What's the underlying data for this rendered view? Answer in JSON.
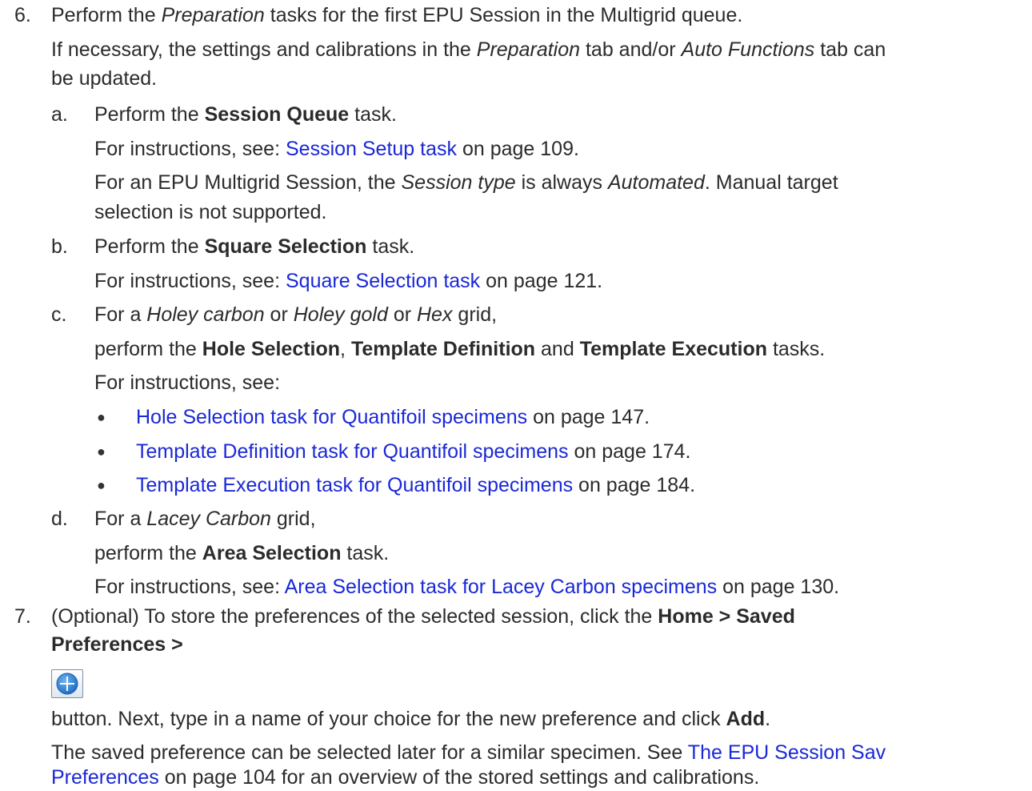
{
  "step6": {
    "number": "6.",
    "line1": [
      "Perform the ",
      "Preparation",
      " tasks for the first EPU Session in the Multigrid queue."
    ],
    "line2": [
      "If necessary, the settings and calibrations in the ",
      "Preparation",
      " tab and/or ",
      "Auto Functions",
      " tab can"
    ],
    "line3": "be updated.",
    "a": {
      "letter": "a.",
      "line1": [
        "Perform the ",
        "Session Queue",
        " task."
      ],
      "line2": [
        "For instructions, see: ",
        "Session Setup task",
        " on page 109."
      ],
      "line3": [
        "For an EPU Multigrid Session, the ",
        "Session type",
        " is always ",
        "Automated",
        ". Manual target"
      ],
      "line4": "selection is not supported."
    },
    "b": {
      "letter": "b.",
      "line1": [
        "Perform the ",
        "Square Selection",
        " task."
      ],
      "line2": [
        "For instructions, see: ",
        "Square Selection task",
        " on page 121."
      ]
    },
    "c": {
      "letter": "c.",
      "line1": [
        "For a ",
        "Holey carbon",
        " or ",
        "Holey gold",
        " or ",
        "Hex",
        " grid,"
      ],
      "line2": [
        "perform the ",
        "Hole Selection",
        ", ",
        "Template Definition",
        " and ",
        "Template Execution",
        " tasks."
      ],
      "line3": "For instructions, see:",
      "bullets": [
        {
          "symbol": "●",
          "link": "Hole Selection task for Quantifoil specimens",
          "suffix": " on page 147."
        },
        {
          "symbol": "●",
          "link": "Template Definition task for Quantifoil specimens",
          "suffix": " on page 174."
        },
        {
          "symbol": "●",
          "link": "Template Execution task for Quantifoil specimens",
          "suffix": " on page 184."
        }
      ]
    },
    "d": {
      "letter": "d.",
      "line1": [
        "For a ",
        "Lacey Carbon",
        " grid,"
      ],
      "line2": [
        "perform the ",
        "Area Selection",
        " task."
      ],
      "line3": [
        "For instructions, see: ",
        "Area Selection task for Lacey Carbon specimens",
        " on page 130."
      ]
    }
  },
  "step7": {
    "number": "7.",
    "line1": [
      "(Optional) To store the preferences of the selected session, click the ",
      "Home > Saved"
    ],
    "line2": "Preferences >",
    "add_icon": "add-circle-icon",
    "line3": [
      "button. Next, type in a name of your choice for the new preference and click ",
      "Add",
      "."
    ],
    "line4": [
      "The saved preference can be selected later for a similar specimen. See ",
      "The EPU Session Sav"
    ],
    "line5": [
      "Preferences",
      " on page 104 for an overview of the stored settings and calibrations."
    ]
  },
  "colors": {
    "text": "#2b2b2b",
    "link": "#1a28d6",
    "icon_blue": "#2f7fd6"
  }
}
